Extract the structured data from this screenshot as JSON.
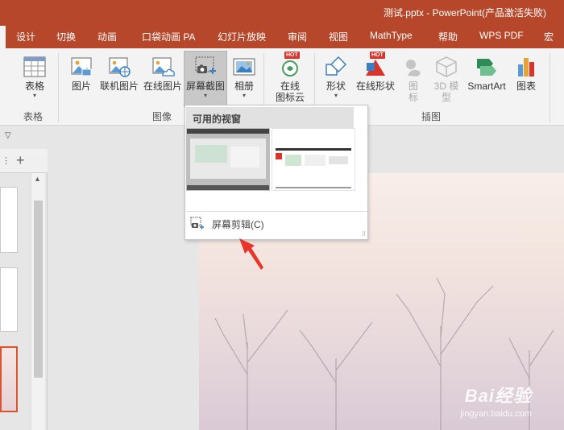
{
  "window": {
    "title": "测试.pptx  -  PowerPoint(产品激活失败)"
  },
  "tabs": [
    "设计",
    "切换",
    "动画",
    "口袋动画 PA",
    "幻灯片放映",
    "审阅",
    "视图",
    "MathType",
    "帮助",
    "WPS PDF",
    "宏"
  ],
  "ribbon": {
    "groups": {
      "tables": "表格",
      "images": "图像",
      "illustrations": "插图"
    },
    "buttons": {
      "table": "表格",
      "picture": "图片",
      "online_pictures": "联机图片",
      "online_pics2": "在线图片",
      "screenshot": "屏幕截图",
      "album": "相册",
      "online_icons_1": "在线",
      "online_icons_2": "图标云",
      "shapes": "形状",
      "online_shapes": "在线形状",
      "icons_1": "图",
      "icons_2": "标",
      "model3d": "3D 模",
      "model3d_2": "型",
      "smartart": "SmartArt",
      "chart": "图表"
    },
    "hot_badge": "HOT"
  },
  "dropdown": {
    "header": "可用的视窗",
    "clip_item": "屏幕剪辑(C)"
  },
  "watermark": {
    "line1": "Bai经验",
    "line2": "jingyan.baidu.com"
  },
  "colors": {
    "brand": "#b7472a",
    "ribbon": "#f3f3f3",
    "arrow": "#e8352b"
  }
}
